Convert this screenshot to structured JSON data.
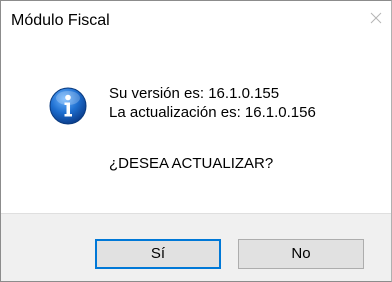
{
  "window": {
    "title": "Módulo Fiscal"
  },
  "icons": {
    "message_icon": "info-icon",
    "close_icon": "close-icon"
  },
  "message": {
    "current_version": "Su versión es: 16.1.0.155",
    "update_version": "La actualización es: 16.1.0.156",
    "question": "¿DESEA ACTUALIZAR?"
  },
  "buttons": {
    "yes_label": "Sí",
    "no_label": "No"
  },
  "colors": {
    "info_blue": "#1565c0",
    "focus_border": "#0078d7",
    "footer_bg": "#f0f0f0"
  }
}
